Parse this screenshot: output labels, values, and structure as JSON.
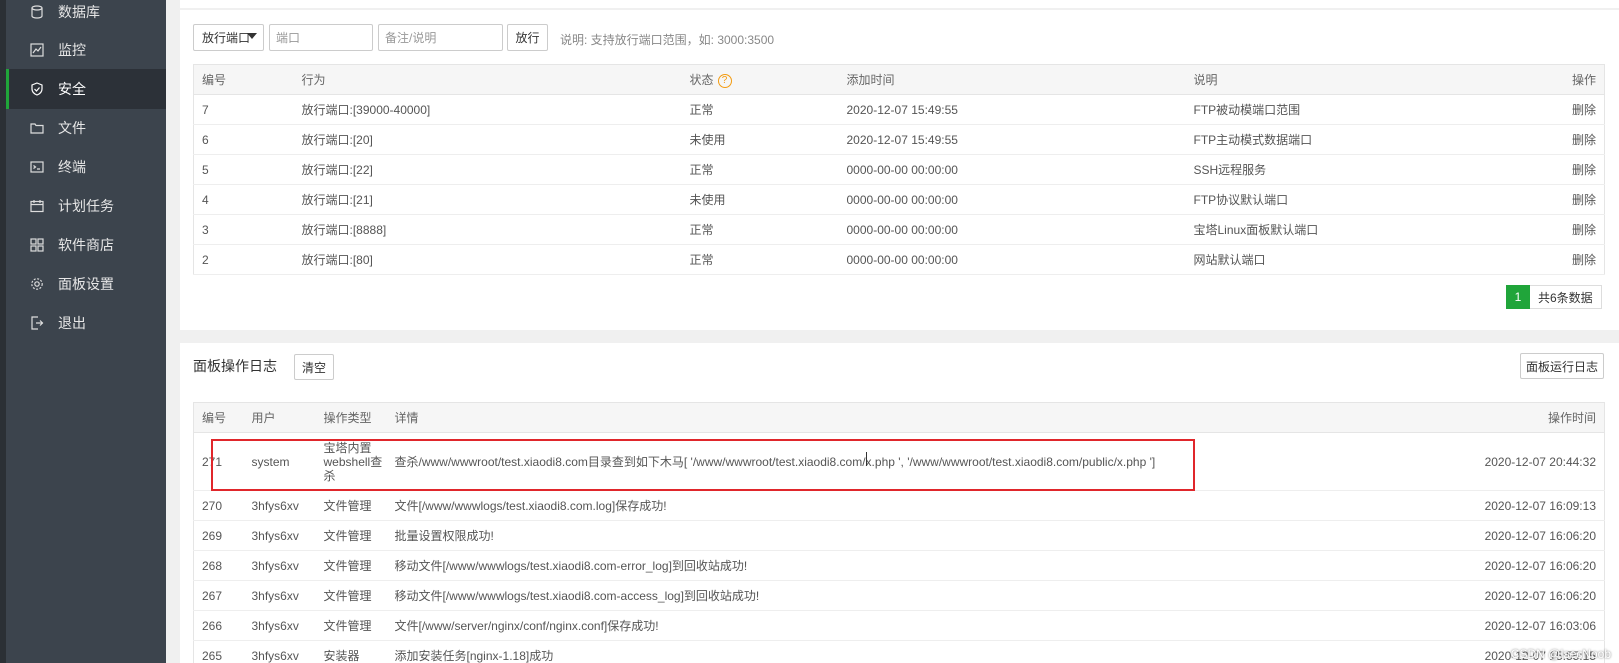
{
  "sidebar": {
    "items": [
      {
        "label": "数据库",
        "icon": "database-icon"
      },
      {
        "label": "监控",
        "icon": "monitor-icon"
      },
      {
        "label": "安全",
        "icon": "shield-icon",
        "active": true
      },
      {
        "label": "文件",
        "icon": "folder-icon"
      },
      {
        "label": "终端",
        "icon": "terminal-icon"
      },
      {
        "label": "计划任务",
        "icon": "calendar-icon"
      },
      {
        "label": "软件商店",
        "icon": "grid-icon"
      },
      {
        "label": "面板设置",
        "icon": "gear-icon"
      },
      {
        "label": "退出",
        "icon": "logout-icon"
      }
    ]
  },
  "firewall": {
    "protocol_select": "放行端口",
    "port_placeholder": "端口",
    "note_placeholder": "备注/说明",
    "allow_button": "放行",
    "hint": "说明: 支持放行端口范围，如: 3000:3500",
    "columns": [
      "编号",
      "行为",
      "状态",
      "添加时间",
      "说明",
      "操作"
    ],
    "rows": [
      {
        "id": "7",
        "action": "放行端口:[39000-40000]",
        "status": "正常",
        "time": "2020-12-07 15:49:55",
        "note": "FTP被动模端口范围",
        "op": "删除"
      },
      {
        "id": "6",
        "action": "放行端口:[20]",
        "status": "未使用",
        "time": "2020-12-07 15:49:55",
        "note": "FTP主动模式数据端口",
        "op": "删除"
      },
      {
        "id": "5",
        "action": "放行端口:[22]",
        "status": "正常",
        "time": "0000-00-00 00:00:00",
        "note": "SSH远程服务",
        "op": "删除"
      },
      {
        "id": "4",
        "action": "放行端口:[21]",
        "status": "未使用",
        "time": "0000-00-00 00:00:00",
        "note": "FTP协议默认端口",
        "op": "删除"
      },
      {
        "id": "3",
        "action": "放行端口:[8888]",
        "status": "正常",
        "time": "0000-00-00 00:00:00",
        "note": "宝塔Linux面板默认端口",
        "op": "删除"
      },
      {
        "id": "2",
        "action": "放行端口:[80]",
        "status": "正常",
        "time": "0000-00-00 00:00:00",
        "note": "网站默认端口",
        "op": "删除"
      }
    ],
    "pager": {
      "current": "1",
      "total": "共6条数据"
    }
  },
  "log": {
    "title": "面板操作日志",
    "clear_button": "清空",
    "run_log_button": "面板运行日志",
    "columns": [
      "编号",
      "用户",
      "操作类型",
      "详情",
      "操作时间"
    ],
    "rows": [
      {
        "id": "271",
        "user": "system",
        "type": "宝塔内置webshell查杀",
        "detail": "查杀/www/wwwroot/test.xiaodi8.com目录查到如下木马[ '/www/wwwroot/test.xiaodi8.com/x.php ', '/www/wwwroot/test.xiaodi8.com/public/x.php ']",
        "time": "2020-12-07 20:44:32"
      },
      {
        "id": "270",
        "user": "3hfys6xv",
        "type": "文件管理",
        "detail": "文件[/www/wwwlogs/test.xiaodi8.com.log]保存成功!",
        "time": "2020-12-07 16:09:13"
      },
      {
        "id": "269",
        "user": "3hfys6xv",
        "type": "文件管理",
        "detail": "批量设置权限成功!",
        "time": "2020-12-07 16:06:20"
      },
      {
        "id": "268",
        "user": "3hfys6xv",
        "type": "文件管理",
        "detail": "移动文件[/www/wwwlogs/test.xiaodi8.com-error_log]到回收站成功!",
        "time": "2020-12-07 16:06:20"
      },
      {
        "id": "267",
        "user": "3hfys6xv",
        "type": "文件管理",
        "detail": "移动文件[/www/wwwlogs/test.xiaodi8.com-access_log]到回收站成功!",
        "time": "2020-12-07 16:06:20"
      },
      {
        "id": "266",
        "user": "3hfys6xv",
        "type": "文件管理",
        "detail": "文件[/www/server/nginx/conf/nginx.conf]保存成功!",
        "time": "2020-12-07 16:03:06"
      },
      {
        "id": "265",
        "user": "3hfys6xv",
        "type": "安装器",
        "detail": "添加安装任务[nginx-1.18]成功",
        "time": "2020-12-07 15:55:15"
      }
    ]
  },
  "watermark": "CSDN @IsecNoob",
  "colors": {
    "accent": "#20a53a",
    "highlight": "#e0262b",
    "sidebar": "#3c444d"
  }
}
